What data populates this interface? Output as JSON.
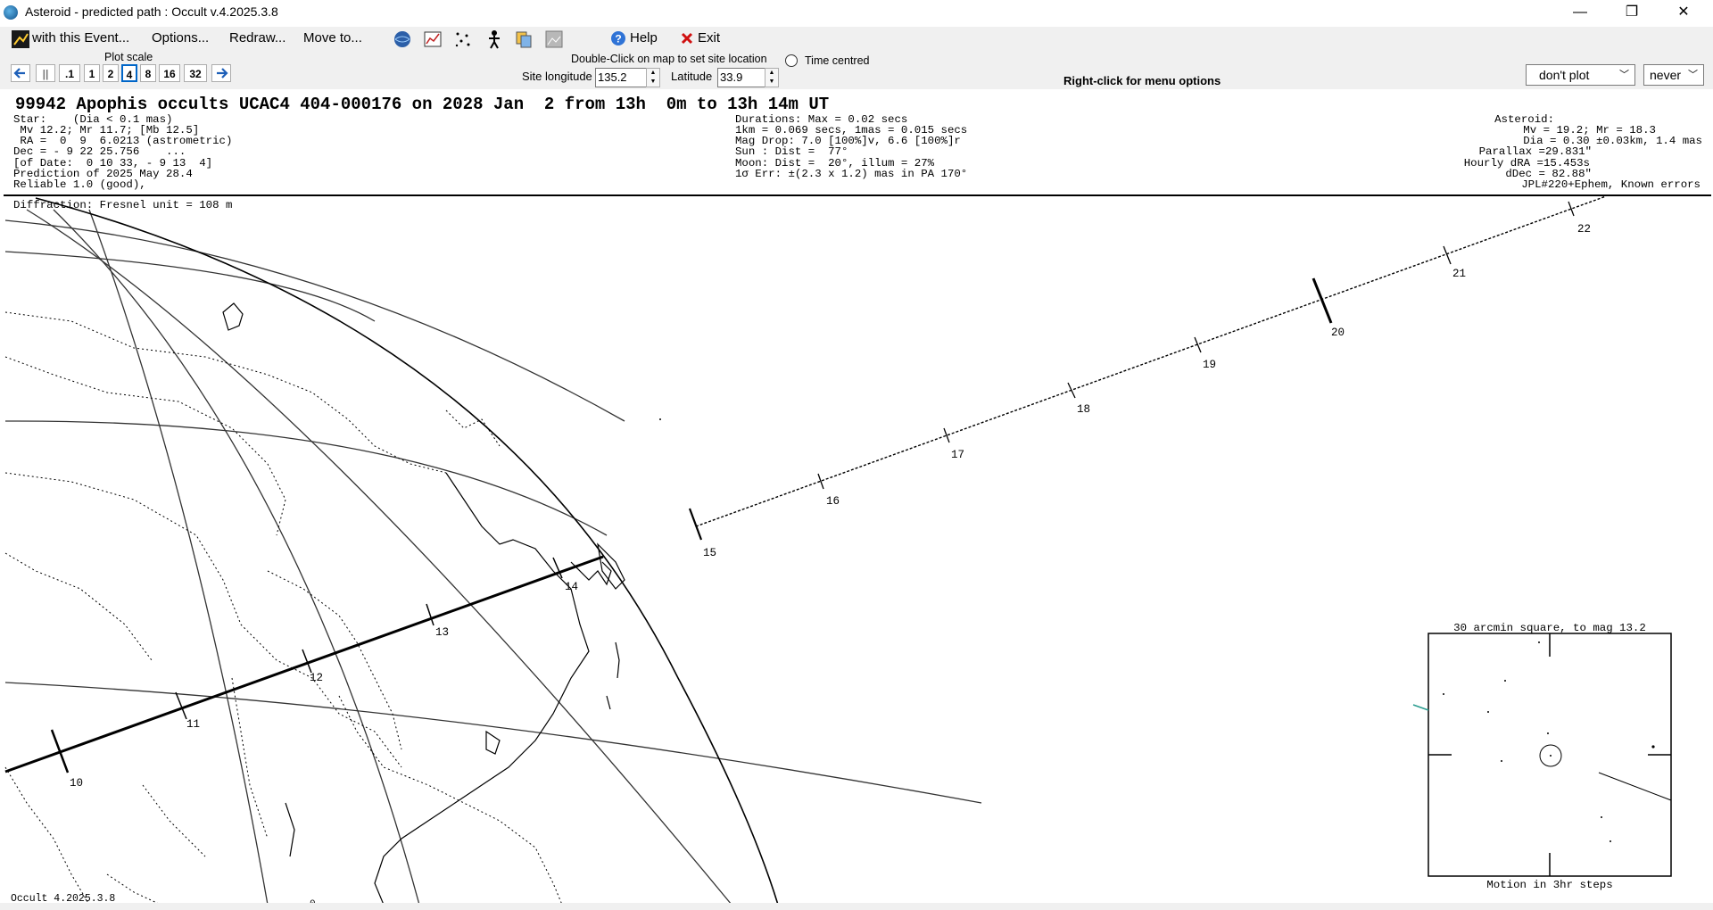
{
  "window": {
    "title": "Asteroid - predicted path : Occult v.4.2025.3.8",
    "minimize": "—",
    "maximize": "❐",
    "close": "✕"
  },
  "menu": {
    "with_event": "with this Event...",
    "options": "Options...",
    "redraw": "Redraw...",
    "move_to": "Move to...",
    "help": "Help",
    "exit": "Exit"
  },
  "toolbar": {
    "plot_scale_label": "Plot scale",
    "scales": [
      ".1",
      "1",
      "2",
      "4",
      "8",
      "16",
      "32"
    ],
    "selected_scale": "4",
    "pause_label": "||",
    "dblclick_hint": "Double-Click on map to set site location",
    "time_centred": "Time centred",
    "site_longitude_label": "Site longitude",
    "site_longitude": "135.2",
    "latitude_label": "Latitude",
    "latitude": "33.9",
    "right_click_hint": "Right-click for menu options",
    "plot_option": "don't plot",
    "never_option": "never"
  },
  "event": {
    "title": "99942 Apophis occults UCAC4 404-000176 on 2028 Jan  2 from 13h  0m to 13h 14m UT",
    "star_lines": [
      "Star:    (Dia < 0.1 mas)",
      " Mv 12.2; Mr 11.7; [Mb 12.5]",
      " RA =  0  9  6.0213 (astrometric)",
      "Dec = - 9 22 25.756    ...",
      "[of Date:  0 10 33, - 9 13  4]",
      "Prediction of 2025 May 28.4",
      "Reliable 1.0 (good),"
    ],
    "duration_lines": [
      "Durations: Max = 0.02 secs",
      "1km = 0.069 secs, 1mas = 0.015 secs",
      "Mag Drop: 7.0 [100%]v, 6.6 [100%]r",
      "Sun : Dist =  77°",
      "Moon: Dist =  20°, illum = 27%",
      "1σ Err: ±(2.3 x 1.2) mas in PA 170°"
    ],
    "asteroid_lines": [
      "Asteroid:",
      "Mv = 19.2; Mr = 18.3",
      "Dia = 0.30 ±0.03km, 1.4 mas",
      "Parallax =29.831\"",
      "Hourly dRA =15.453s",
      "dDec = 82.88\"",
      "JPL#220+Ephem, Known errors"
    ],
    "diffraction": "Diffraction: Fresnel unit = 108 m"
  },
  "path": {
    "time_labels": [
      "10",
      "11",
      "12",
      "13",
      "14",
      "15",
      "16",
      "17",
      "18",
      "19",
      "20",
      "21",
      "22"
    ]
  },
  "map": {
    "bottom_label": "0",
    "version_footer": "Occult 4.2025.3.8"
  },
  "finder": {
    "title": "30 arcmin square, to mag 13.2",
    "caption": "Motion in 3hr steps"
  },
  "colors": {
    "chrome": "#f0f0f0",
    "accent": "#0066c8",
    "exit_red": "#d01010",
    "motion_teal": "#2a9d8f"
  },
  "icons": [
    "event-icon",
    "globe-icon",
    "chart-icon",
    "starfield-icon",
    "person-icon",
    "copy-icon",
    "image-icon",
    "help-icon",
    "exit-icon"
  ]
}
